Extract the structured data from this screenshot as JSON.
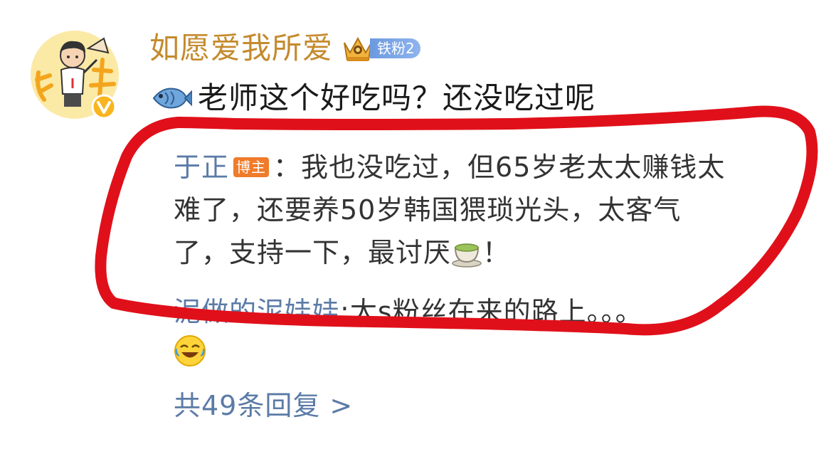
{
  "comment": {
    "username": "如愿爱我所爱",
    "fan_badge_label": "铁粉2",
    "avatar_icon": "cartoon-avatar-icon",
    "verified_icon": "verified-v-icon",
    "emoji_icon": "fish-emoji-icon",
    "text": "老师这个好吃吗？还没吃过呢"
  },
  "replies": [
    {
      "author": "于正",
      "tag": "博主",
      "separator": "：",
      "line1": "我也没吃过，但65岁老太太赚钱太",
      "line2": "难了，还要养50岁韩国猥琐光头，太客气",
      "line3_before_icon": "了，支持一下，最讨厌",
      "icon": "tea-cup-emoji-icon",
      "line3_after_icon": "！"
    },
    {
      "author": "泥做的泥娃娃",
      "separator": ":",
      "text": "太s粉丝在来的路上。。。",
      "trailing_icon": "laugh-cry-emoji-icon"
    }
  ],
  "more_replies_label": "共49条回复 >",
  "colors": {
    "username": "#c48a2d",
    "link_blue": "#5b7ba7",
    "blogger_tag": "#f07b2a",
    "annotation_red": "#e0101a"
  }
}
